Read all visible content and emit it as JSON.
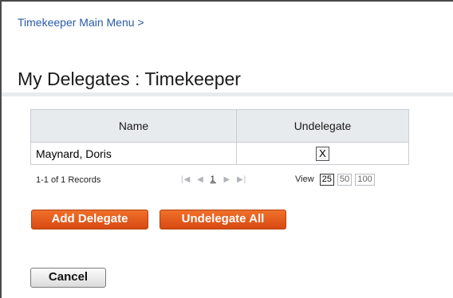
{
  "breadcrumb": {
    "label": "Timekeeper Main Menu >"
  },
  "page": {
    "title": "My Delegates : Timekeeper"
  },
  "table": {
    "headers": [
      "Name",
      "Undelegate"
    ],
    "rows": [
      {
        "name": "Maynard, Doris",
        "action": "X"
      }
    ]
  },
  "pager": {
    "records": "1-1 of 1 Records",
    "nav": {
      "first": "|◀",
      "prev": "◀",
      "page": "1",
      "next": "▶",
      "last": "▶|"
    },
    "view_label": "View",
    "view_options": [
      "25",
      "50",
      "100"
    ],
    "selected_view": "25"
  },
  "buttons": {
    "add_delegate": "Add Delegate",
    "undelegate_all": "Undelegate All",
    "cancel": "Cancel"
  },
  "colors": {
    "accent": "#e85d1f",
    "link": "#2a5aa8"
  }
}
